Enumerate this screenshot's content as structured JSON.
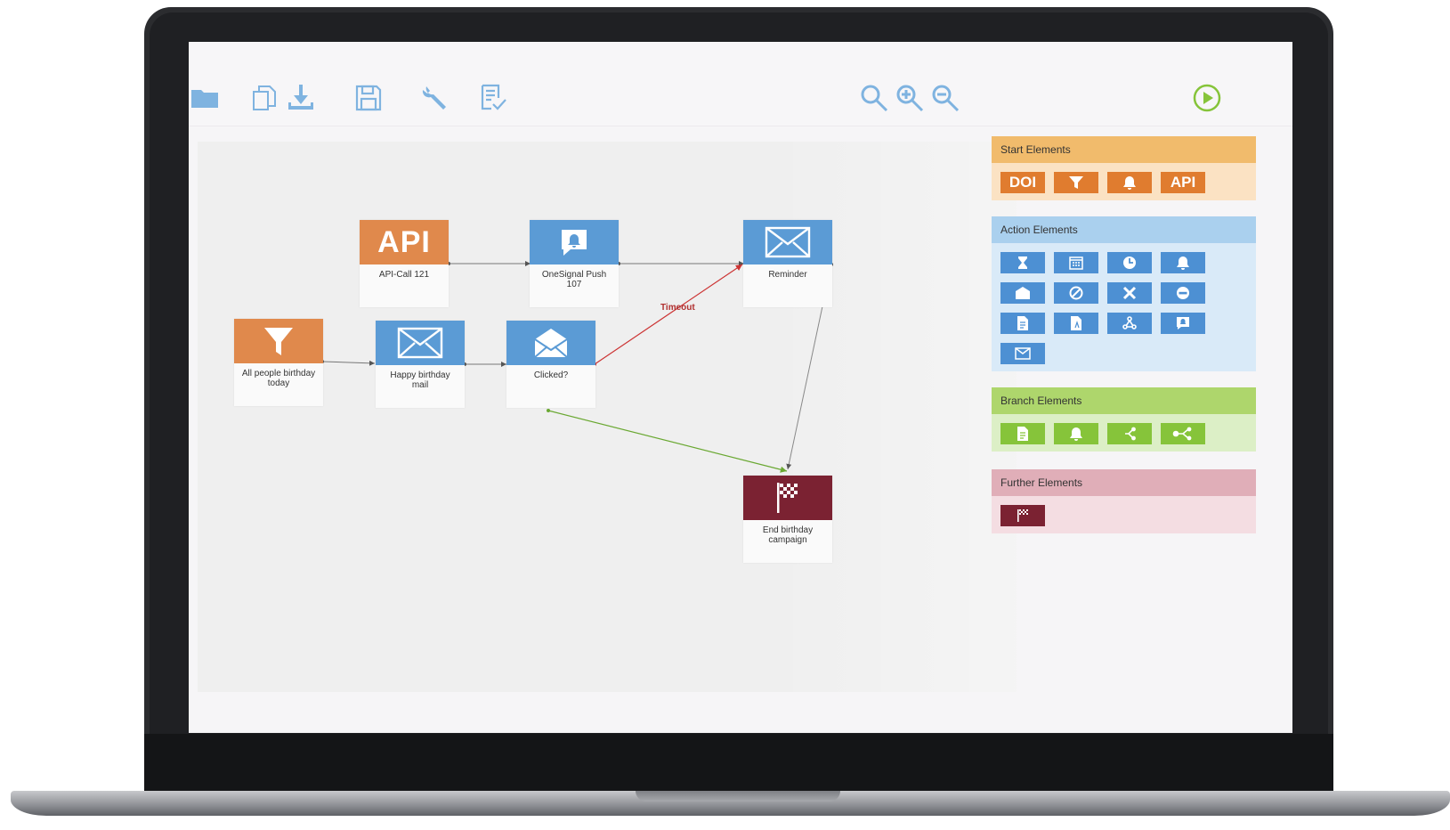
{
  "toolbar": {
    "icons": [
      "folder-icon",
      "copy-icon",
      "download-icon",
      "save-icon",
      "wrench-icon",
      "checklist-icon",
      "search-icon",
      "zoom-in-icon",
      "zoom-out-icon",
      "play-icon"
    ]
  },
  "workflow": {
    "nodes": {
      "api_call": {
        "head": "API",
        "label": "API-Call 121"
      },
      "onesignal": {
        "label": "OneSignal Push 107"
      },
      "reminder": {
        "label": "Reminder"
      },
      "filter": {
        "label": "All people birthday today"
      },
      "birthday_mail": {
        "label": "Happy birthday mail"
      },
      "clicked": {
        "label": "Clicked?"
      },
      "end": {
        "label": "End birthday campaign"
      }
    },
    "edge_label_timeout": "Timeout"
  },
  "palette": {
    "start": {
      "title": "Start Elements",
      "doi": "DOI",
      "api": "API"
    },
    "action": {
      "title": "Action Elements"
    },
    "branch": {
      "title": "Branch Elements"
    },
    "further": {
      "title": "Further Elements"
    }
  },
  "colors": {
    "start": "#e07c2f",
    "action": "#4d90d3",
    "branch": "#86c43a",
    "further": "#7b2232",
    "edge_default": "#666666",
    "edge_timeout": "#cc3333",
    "edge_yes": "#6aa832"
  }
}
